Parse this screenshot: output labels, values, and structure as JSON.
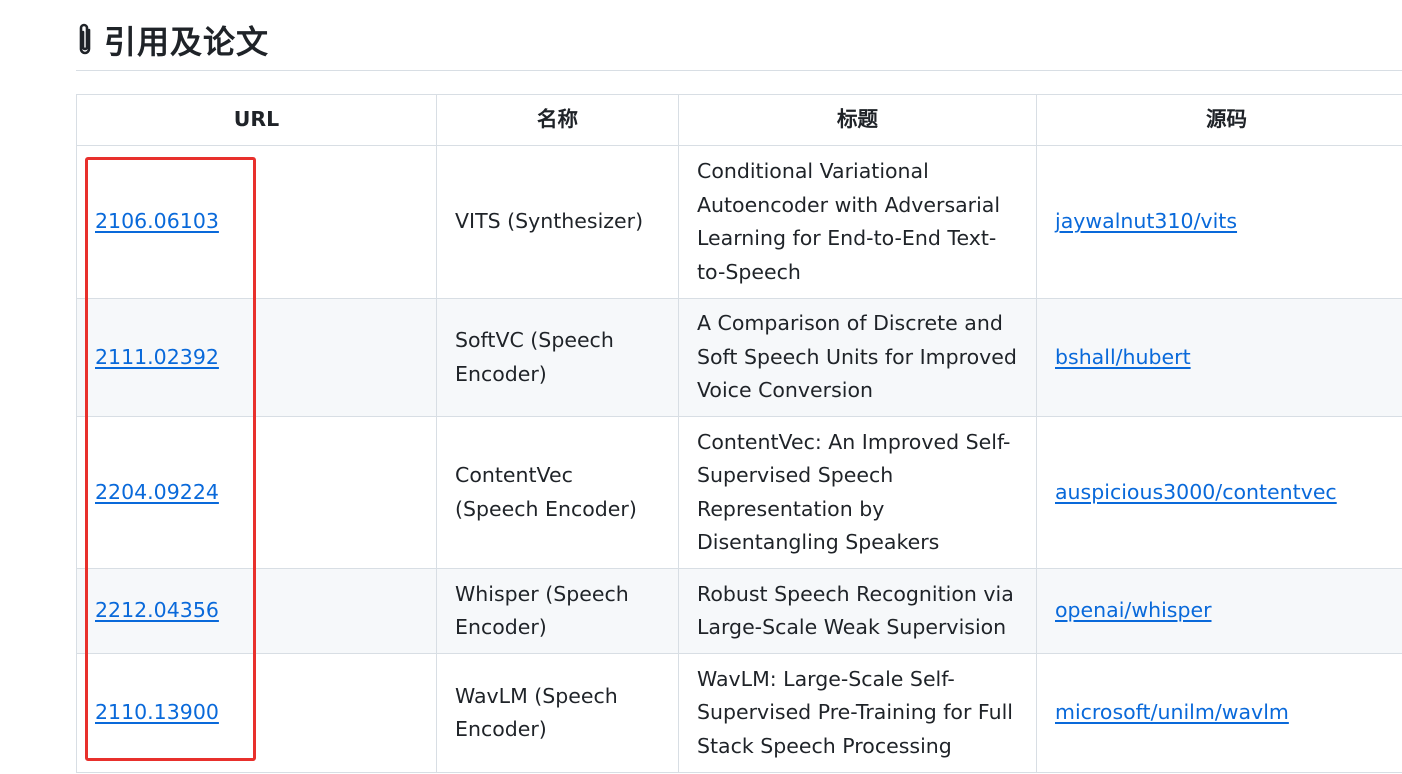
{
  "section": {
    "icon": "paperclip-icon",
    "title": "引用及论文"
  },
  "table": {
    "headers": [
      "URL",
      "名称",
      "标题",
      "源码"
    ],
    "rows": [
      {
        "url": "2106.06103",
        "name": "VITS (Synthesizer)",
        "title": "Conditional Variational Autoencoder with Adversarial Learning for End-to-End Text-to-Speech",
        "source": "jaywalnut310/vits"
      },
      {
        "url": "2111.02392",
        "name": "SoftVC (Speech Encoder)",
        "title": "A Comparison of Discrete and Soft Speech Units for Improved Voice Conversion",
        "source": "bshall/hubert"
      },
      {
        "url": "2204.09224",
        "name": "ContentVec (Speech Encoder)",
        "title": "ContentVec: An Improved Self-Supervised Speech Representation by Disentangling Speakers",
        "source": "auspicious3000/contentvec"
      },
      {
        "url": "2212.04356",
        "name": "Whisper (Speech Encoder)",
        "title": "Robust Speech Recognition via Large-Scale Weak Supervision",
        "source": "openai/whisper"
      },
      {
        "url": "2110.13900",
        "name": "WavLM (Speech Encoder)",
        "title": "WavLM: Large-Scale Self-Supervised Pre-Training for Full Stack Speech Processing",
        "source": "microsoft/unilm/wavlm"
      }
    ]
  },
  "colors": {
    "link": "#0969da",
    "highlight": "#e8302c",
    "stripe": "#f6f8fa",
    "border": "#d8dee4"
  }
}
